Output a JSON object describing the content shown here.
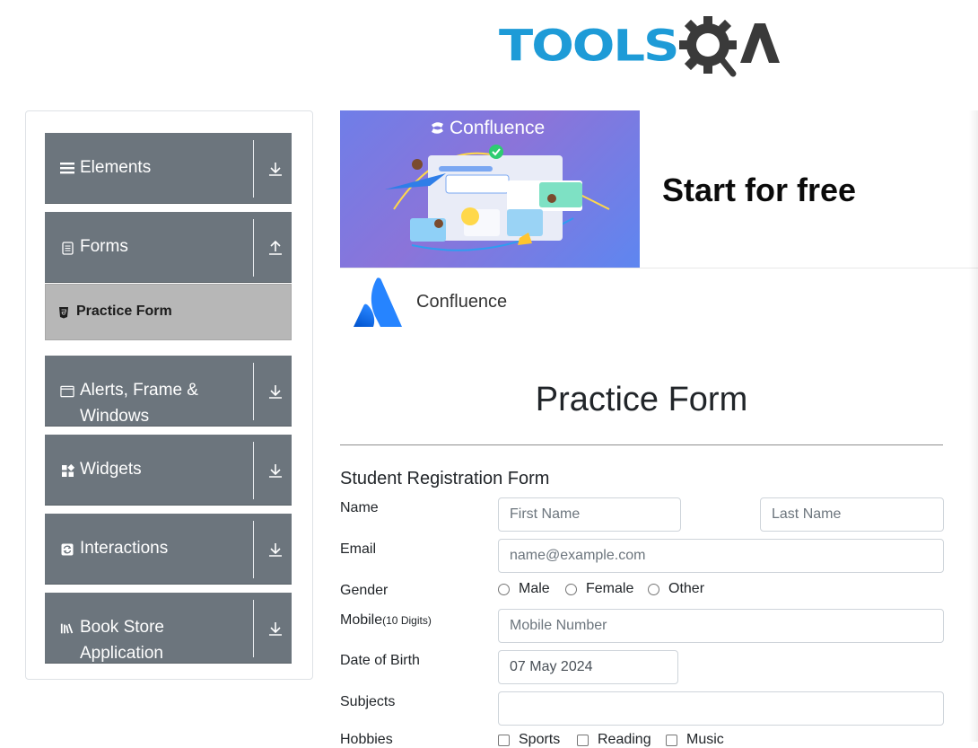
{
  "header": {
    "logo_text": "TOOLS",
    "logo_suffix": "QA"
  },
  "sidebar": {
    "groups": [
      {
        "label": "Elements",
        "icon": "hamburger-icon",
        "arrow": "download-icon"
      },
      {
        "label": "Forms",
        "icon": "document-icon",
        "arrow": "upload-icon"
      },
      {
        "label": "Alerts, Frame & Windows",
        "icon": "window-icon",
        "arrow": "download-icon"
      },
      {
        "label": "Widgets",
        "icon": "widgets-icon",
        "arrow": "download-icon"
      },
      {
        "label": "Interactions",
        "icon": "interactions-icon",
        "arrow": "download-icon"
      },
      {
        "label": "Book Store Application",
        "icon": "books-icon",
        "arrow": "download-icon"
      }
    ],
    "active_item": {
      "label": "Practice Form",
      "icon": "html5-icon"
    }
  },
  "ad": {
    "image_brand": "Confluence",
    "headline": "Start for free",
    "brand_name": "Confluence"
  },
  "form": {
    "page_title": "Practice Form",
    "section_title": "Student Registration Form",
    "name_label": "Name",
    "first_name_placeholder": "First Name",
    "last_name_placeholder": "Last Name",
    "email_label": "Email",
    "email_placeholder": "name@example.com",
    "gender_label": "Gender",
    "gender_options": [
      "Male",
      "Female",
      "Other"
    ],
    "mobile_label": "Mobile",
    "mobile_hint": "(10 Digits)",
    "mobile_placeholder": "Mobile Number",
    "dob_label": "Date of Birth",
    "dob_value": "07 May 2024",
    "subjects_label": "Subjects",
    "hobbies_label": "Hobbies",
    "hobbies_options": [
      "Sports",
      "Reading",
      "Music"
    ]
  },
  "colors": {
    "sidebar_bg": "#6c757d",
    "active_item_bg": "#b7b7b7",
    "logo_blue": "#1e9bd7",
    "logo_dark": "#3a3a3a"
  }
}
